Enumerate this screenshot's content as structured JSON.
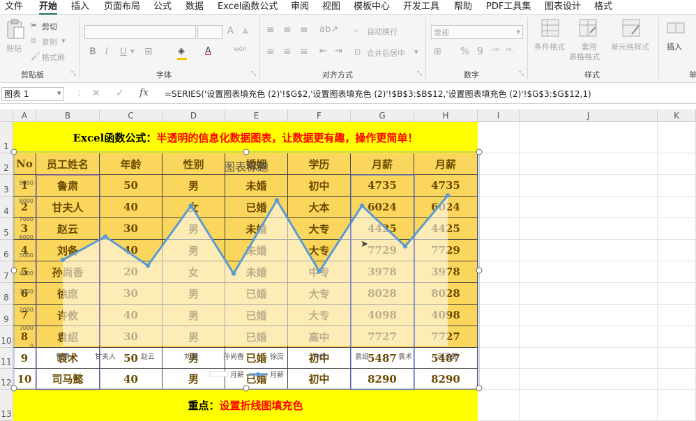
{
  "menu_tabs": [
    "文件",
    "开始",
    "插入",
    "页面布局",
    "公式",
    "数据",
    "Excel函数公式",
    "审阅",
    "视图",
    "模板中心",
    "开发工具",
    "帮助",
    "PDF工具集",
    "图表设计",
    "格式"
  ],
  "active_tab": "开始",
  "ribbon": {
    "paste": "粘贴",
    "cut": "剪切",
    "copy": "复制",
    "format_painter": "格式刷",
    "clipboard_group": "剪贴板",
    "bold": "B",
    "italic": "I",
    "underline": "U",
    "font_grow": "A",
    "font_shrink": "A",
    "wen": "wén",
    "font_group": "字体",
    "wrap_text": "自动换行",
    "merge_center": "合并后居中",
    "align_group": "对齐方式",
    "number_format": "常规",
    "percent": "%",
    "comma": "9",
    "number_group": "数字",
    "cond_format": "条件格式",
    "table_format_1": "套用",
    "table_format_2": "表格格式",
    "cell_style": "单元格样式",
    "styles_group": "样式",
    "insert": "插入",
    "cells_group_partial": "单"
  },
  "formula_bar": {
    "name_box": "图表 1",
    "fx": "fx",
    "formula": "=SERIES('设置图表填充色 (2)'!$G$2,'设置图表填充色 (2)'!$B$3:$B$12,'设置图表填充色 (2)'!$G$3:$G$12,1)"
  },
  "columns": [
    "A",
    "B",
    "C",
    "D",
    "E",
    "F",
    "G",
    "H",
    "I",
    "J",
    "K"
  ],
  "rows": [
    "1",
    "2",
    "3",
    "4",
    "5",
    "6",
    "7",
    "8",
    "9",
    "10",
    "11",
    "12",
    "13"
  ],
  "sheet": {
    "title_prefix": "Excel函数公式：",
    "title_main": "半透明的信息化数据图表，让数据更有趣，操作更简单！",
    "headers": [
      "No",
      "员工姓名",
      "年龄",
      "性别",
      "婚姻",
      "学历",
      "月薪",
      "月薪"
    ],
    "data": [
      [
        "1",
        "鲁肃",
        "50",
        "男",
        "未婚",
        "初中",
        "4735",
        "4735"
      ],
      [
        "2",
        "甘夫人",
        "40",
        "女",
        "已婚",
        "大本",
        "6024",
        "6024"
      ],
      [
        "3",
        "赵云",
        "30",
        "男",
        "未婚",
        "大专",
        "4425",
        "4425"
      ],
      [
        "4",
        "刘备",
        "40",
        "男",
        "未婚",
        "大专",
        "7729",
        "7729"
      ],
      [
        "5",
        "孙尚香",
        "20",
        "女",
        "未婚",
        "中专",
        "3978",
        "3978"
      ],
      [
        "6",
        "徐庶",
        "30",
        "男",
        "已婚",
        "大专",
        "8028",
        "8028"
      ],
      [
        "7",
        "许攸",
        "40",
        "男",
        "已婚",
        "大专",
        "4098",
        "4098"
      ],
      [
        "8",
        "袁绍",
        "30",
        "男",
        "已婚",
        "高中",
        "7727",
        "7727"
      ],
      [
        "9",
        "袁术",
        "50",
        "男",
        "已婚",
        "初中",
        "5487",
        "5487"
      ],
      [
        "10",
        "司马懿",
        "40",
        "男",
        "已婚",
        "初中",
        "8290",
        "8290"
      ]
    ],
    "footer_prefix": "重点：",
    "footer_main": "设置折线图填充色"
  },
  "chart_data": {
    "type": "line",
    "title": "图表标题",
    "categories": [
      "鲁肃",
      "甘夫人",
      "赵云",
      "刘备",
      "孙尚香",
      "徐庶",
      "许攸",
      "袁绍",
      "袁术",
      "司马懿"
    ],
    "series": [
      {
        "name": "月薪",
        "values": [
          4735,
          6024,
          4425,
          7729,
          3978,
          8028,
          4098,
          7727,
          5487,
          8290
        ]
      }
    ],
    "y_ticks": [
      0,
      1000,
      2000,
      3000,
      4000,
      5000,
      6000,
      7000,
      8000,
      9000
    ],
    "ylim": [
      0,
      9000
    ],
    "legend_labels": [
      "月薪",
      "月薪"
    ],
    "legend_position": "bottom",
    "line_color": "#5b9bd5",
    "fill": "semi-transparent white area"
  },
  "colors": {
    "yellow": "#ffff00",
    "gold": "#fbd65c",
    "title_black": "#000000",
    "title_red": "#ff0000",
    "accent_green": "#217346"
  }
}
